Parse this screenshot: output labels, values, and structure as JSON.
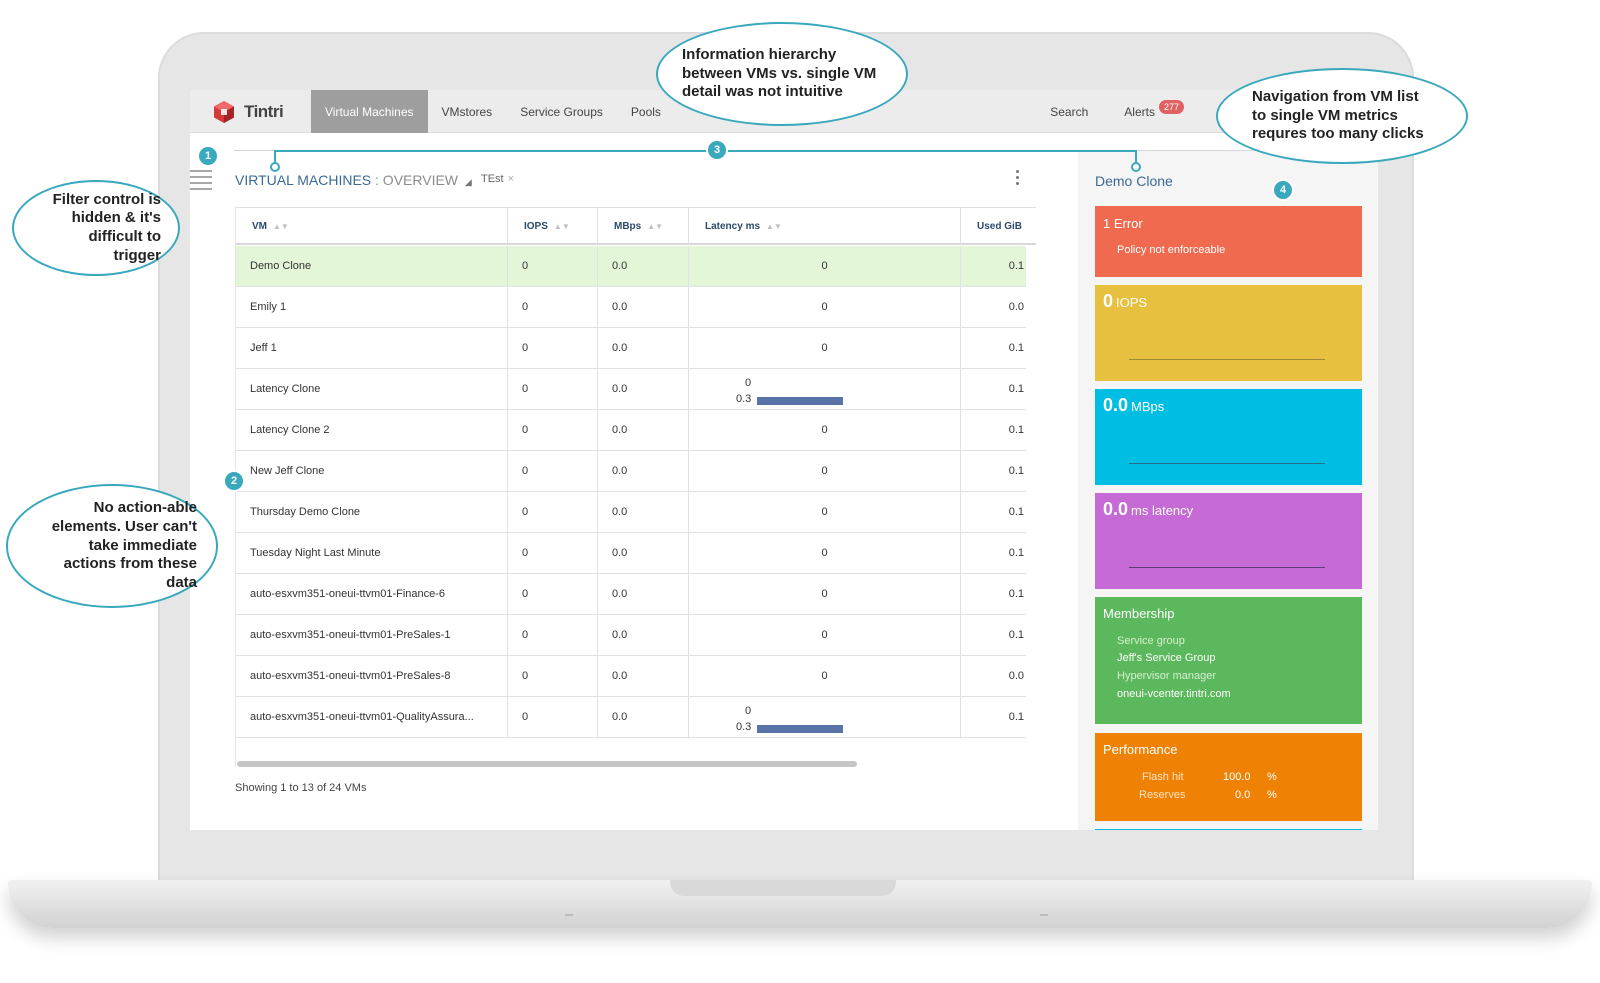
{
  "nav": {
    "logo_text": "Tintri",
    "items": [
      {
        "label": "Virtual Machines",
        "active": true
      },
      {
        "label": "VMstores",
        "active": false
      },
      {
        "label": "Service Groups",
        "active": false
      },
      {
        "label": "Pools",
        "active": false
      }
    ],
    "search_label": "Search",
    "alerts_label": "Alerts",
    "alerts_count": "277"
  },
  "page": {
    "title": "VIRTUAL MACHINES",
    "subtitle": ": OVERVIEW",
    "filter_tag": "TEst",
    "footer": "Showing 1 to 13 of 24 VMs"
  },
  "table": {
    "headers": {
      "vm": "VM",
      "iops": "IOPS",
      "mbps": "MBps",
      "latency": "Latency ms",
      "used": "Used GiB"
    },
    "rows": [
      {
        "vm": "Demo Clone",
        "iops": "0",
        "mbps": "0.0",
        "lat": "0",
        "lat_extra": "",
        "used": "0.1",
        "selected": true
      },
      {
        "vm": "Emily 1",
        "iops": "0",
        "mbps": "0.0",
        "lat": "0",
        "lat_extra": "",
        "used": "0.0"
      },
      {
        "vm": "Jeff 1",
        "iops": "0",
        "mbps": "0.0",
        "lat": "0",
        "lat_extra": "",
        "used": "0.1"
      },
      {
        "vm": "Latency Clone",
        "iops": "0",
        "mbps": "0.0",
        "lat": "0",
        "lat_extra": "0.3",
        "used": "0.1"
      },
      {
        "vm": "Latency Clone 2",
        "iops": "0",
        "mbps": "0.0",
        "lat": "0",
        "lat_extra": "",
        "used": "0.1"
      },
      {
        "vm": "New Jeff Clone",
        "iops": "0",
        "mbps": "0.0",
        "lat": "0",
        "lat_extra": "",
        "used": "0.1"
      },
      {
        "vm": "Thursday Demo Clone",
        "iops": "0",
        "mbps": "0.0",
        "lat": "0",
        "lat_extra": "",
        "used": "0.1"
      },
      {
        "vm": "Tuesday Night Last Minute",
        "iops": "0",
        "mbps": "0.0",
        "lat": "0",
        "lat_extra": "",
        "used": "0.1"
      },
      {
        "vm": "auto-esxvm351-oneui-ttvm01-Finance-6",
        "iops": "0",
        "mbps": "0.0",
        "lat": "0",
        "lat_extra": "",
        "used": "0.1"
      },
      {
        "vm": "auto-esxvm351-oneui-ttvm01-PreSales-1",
        "iops": "0",
        "mbps": "0.0",
        "lat": "0",
        "lat_extra": "",
        "used": "0.1"
      },
      {
        "vm": "auto-esxvm351-oneui-ttvm01-PreSales-8",
        "iops": "0",
        "mbps": "0.0",
        "lat": "0",
        "lat_extra": "",
        "used": "0.0"
      },
      {
        "vm": "auto-esxvm351-oneui-ttvm01-QualityAssura...",
        "iops": "0",
        "mbps": "0.0",
        "lat": "0",
        "lat_extra": "0.3",
        "used": "0.1"
      }
    ]
  },
  "detail": {
    "title": "Demo Clone",
    "error": {
      "title": "1 Error",
      "message": "Policy not enforceable",
      "color": "#ef6a4e"
    },
    "iops": {
      "value": "0",
      "unit": "IOPS",
      "color": "#e8c040"
    },
    "mbps": {
      "value": "0.0",
      "unit": "MBps",
      "color": "#00bde3"
    },
    "latency": {
      "value": "0.0",
      "unit": "ms latency",
      "color": "#c66ad6"
    },
    "membership": {
      "title": "Membership",
      "sg_label": "Service group",
      "sg_value": "Jeff's Service Group",
      "hm_label": "Hypervisor manager",
      "hm_value": "oneui-vcenter.tintri.com",
      "color": "#5cb85c"
    },
    "performance": {
      "title": "Performance",
      "flash_label": "Flash hit",
      "flash_value": "100.0",
      "reserves_label": "Reserves",
      "reserves_value": "0.0",
      "pct": "%",
      "color": "#ef8205"
    }
  },
  "annotations": {
    "a1": {
      "num": "1",
      "text": "Filter control is hidden & it's difficult to trigger"
    },
    "a2": {
      "num": "2",
      "text": "No action-able elements. User can't take immediate actions from these data"
    },
    "a3": {
      "num": "3",
      "text": "Information hierarchy between VMs vs. single VM detail was not intuitive"
    },
    "a4": {
      "num": "4",
      "text": "Navigation from VM list to single VM metrics requres too many clicks"
    }
  }
}
